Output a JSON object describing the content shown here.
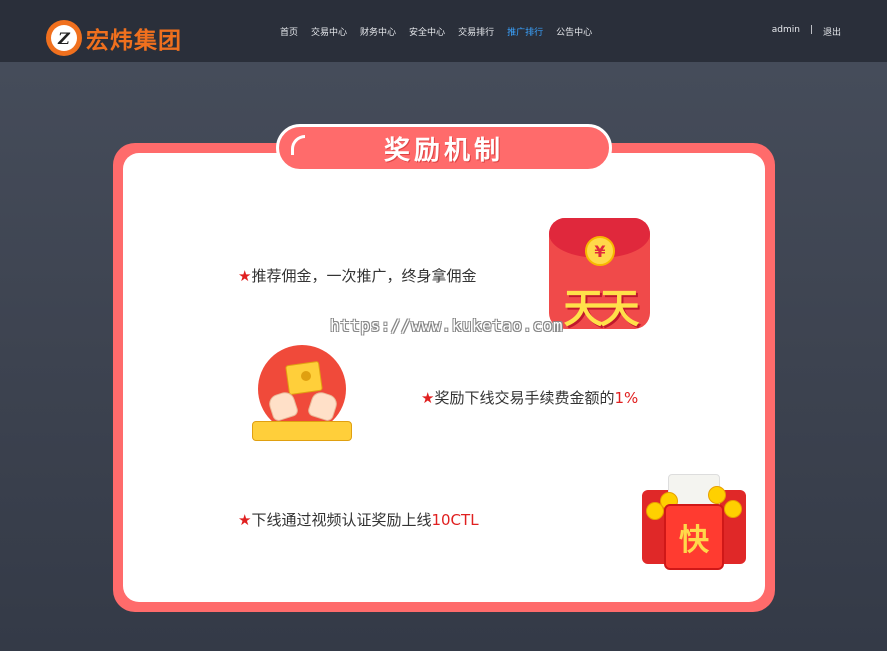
{
  "header": {
    "brand": "宏炜集团",
    "logo_glyph": "Z",
    "nav": [
      {
        "label": "首页",
        "active": false
      },
      {
        "label": "交易中心",
        "active": false
      },
      {
        "label": "财务中心",
        "active": false
      },
      {
        "label": "安全中心",
        "active": false
      },
      {
        "label": "交易排行",
        "active": false
      },
      {
        "label": "推广排行",
        "active": true
      },
      {
        "label": "公告中心",
        "active": false
      }
    ],
    "user": "admin",
    "separator": "|",
    "logout": "退出"
  },
  "card": {
    "title": "奖励机制",
    "rules": [
      {
        "star": "★",
        "text": "推荐佣金，一次推广，终身拿佣金",
        "highlight": ""
      },
      {
        "star": "★",
        "text": "奖励下线交易手续费金额的",
        "highlight": "1%"
      },
      {
        "star": "★",
        "text": "下线通过视频认证奖励上线",
        "highlight": "10CTL"
      }
    ],
    "app_icon": {
      "coin": "¥",
      "label": "天天"
    },
    "envelope": {
      "label": "快"
    }
  },
  "watermark": "https://www.kuketao.com",
  "colors": {
    "accent": "#ff6b6b",
    "highlight": "#e02020",
    "nav_active": "#3aa3ff",
    "brand": "#f0701e"
  }
}
